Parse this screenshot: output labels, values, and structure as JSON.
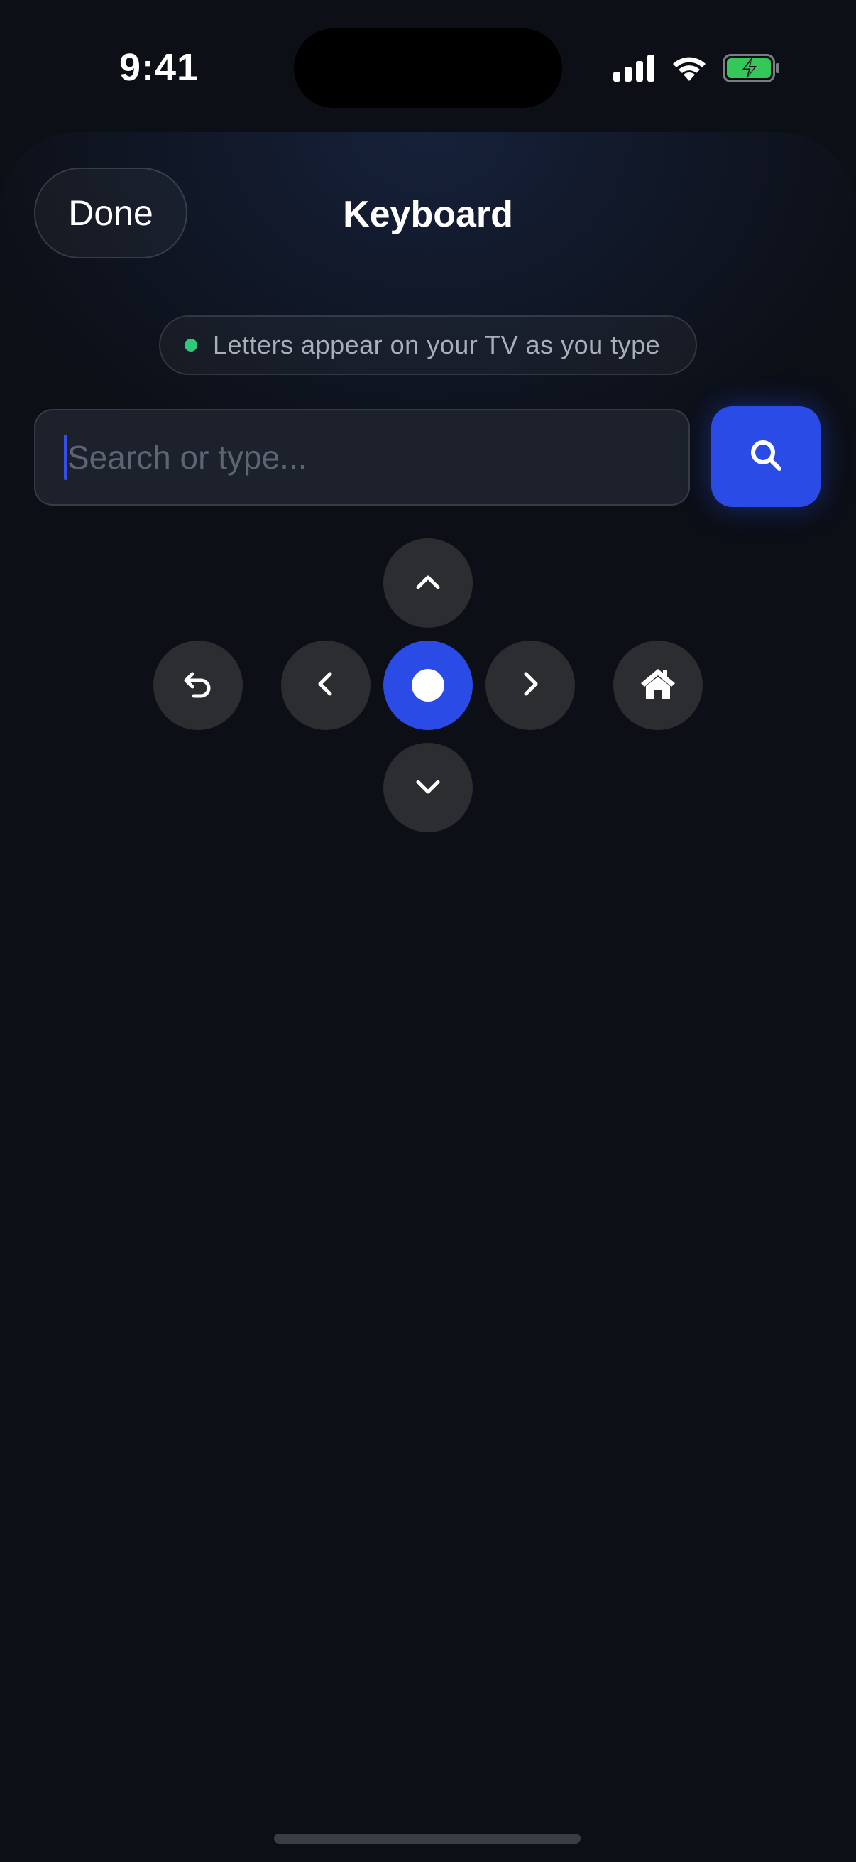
{
  "status_bar": {
    "time": "9:41",
    "battery_color": "#35c759"
  },
  "sheet": {
    "done_label": "Done",
    "title": "Keyboard",
    "hint": "Letters appear on your TV as you type",
    "hint_dot_color": "#2fc97a"
  },
  "search": {
    "placeholder": "Search or type...",
    "value": "",
    "button_icon": "search-icon",
    "accent": "#2b4be6"
  },
  "remote": {
    "buttons": [
      "chevron-up-icon",
      "back-icon",
      "chevron-left-icon",
      "ok-select",
      "chevron-right-icon",
      "home-icon",
      "chevron-down-icon"
    ]
  }
}
